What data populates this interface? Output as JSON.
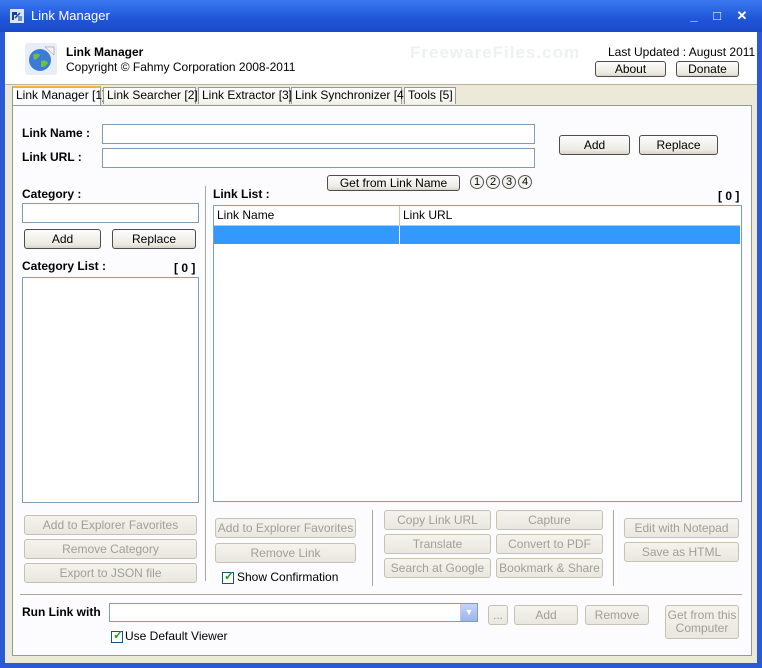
{
  "window": {
    "title": "Link Manager",
    "controls": {
      "minimize": "_",
      "maximize": "□",
      "close": "✕"
    }
  },
  "header": {
    "app_name": "Link Manager",
    "copyright": "Copyright © Fahmy Corporation 2008-2011",
    "watermark": "FreewareFiles.com",
    "last_updated": "Last Updated : August 2011",
    "about_label": "About",
    "donate_label": "Donate"
  },
  "tabs": [
    {
      "label": "Link Manager [1]"
    },
    {
      "label": "Link Searcher [2]"
    },
    {
      "label": "Link Extractor [3]"
    },
    {
      "label": "Link Synchronizer [4]"
    },
    {
      "label": "Tools [5]"
    }
  ],
  "link_form": {
    "name_label": "Link Name :",
    "url_label": "Link URL :",
    "name_value": "",
    "url_value": "",
    "add_label": "Add",
    "replace_label": "Replace",
    "get_from_name_label": "Get from Link Name",
    "number_buttons": [
      "1",
      "2",
      "3",
      "4"
    ]
  },
  "category": {
    "label": "Category :",
    "value": "",
    "add_label": "Add",
    "replace_label": "Replace",
    "list_label": "Category List :",
    "list_count": "[ 0 ]",
    "add_to_favorites_label": "Add to Explorer Favorites",
    "remove_category_label": "Remove Category",
    "export_json_label": "Export to JSON file"
  },
  "link_list": {
    "label": "Link List :",
    "count": "[ 0 ]",
    "columns": [
      "Link Name",
      "Link URL"
    ],
    "add_to_favorites_label": "Add to Explorer Favorites",
    "remove_link_label": "Remove Link",
    "show_confirmation_label": "Show Confirmation",
    "show_confirmation_checked": true
  },
  "actions": {
    "copy_link_url": "Copy Link URL",
    "capture": "Capture",
    "translate": "Translate",
    "convert_to_pdf": "Convert to PDF",
    "search_at_google": "Search at Google",
    "bookmark_share": "Bookmark & Share",
    "edit_with_notepad": "Edit with Notepad",
    "save_as_html": "Save as HTML"
  },
  "run_link": {
    "label": "Run Link with",
    "value": "",
    "browse_label": "...",
    "add_label": "Add",
    "remove_label": "Remove",
    "get_from_computer_line1": "Get from this",
    "get_from_computer_line2": "Computer",
    "use_default_viewer_label": "Use Default Viewer",
    "use_default_viewer_checked": true
  }
}
